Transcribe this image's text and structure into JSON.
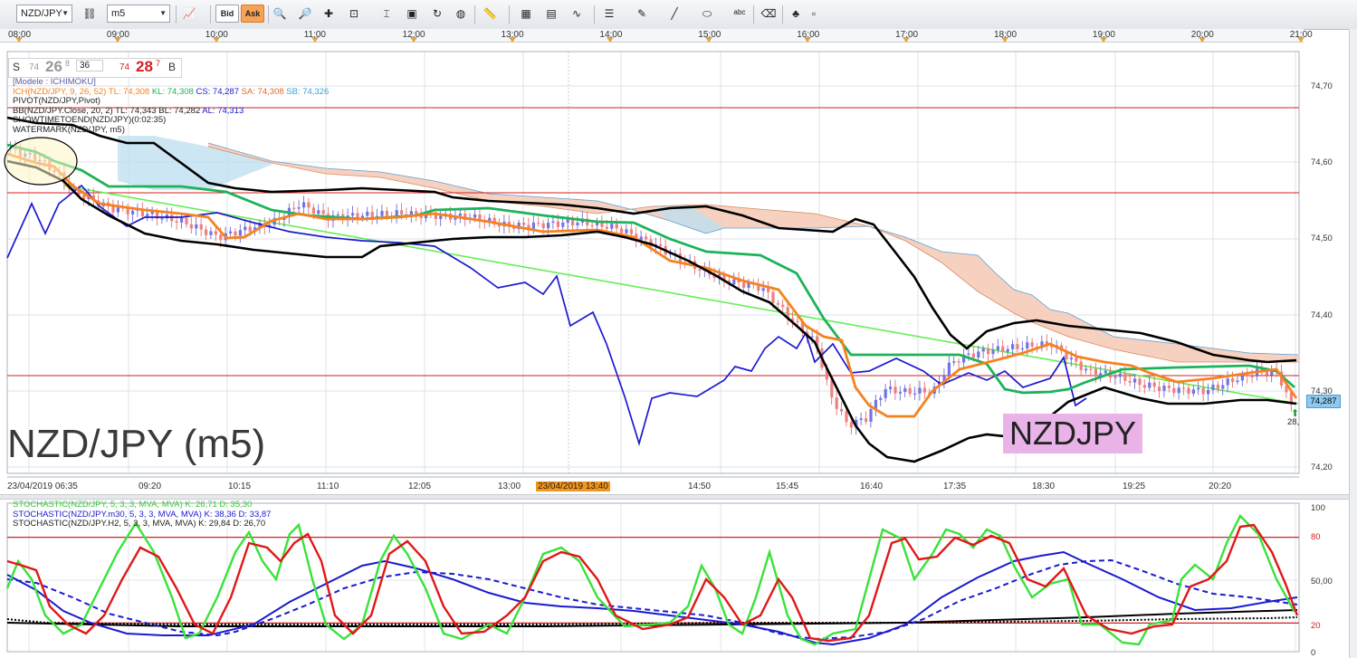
{
  "toolbar": {
    "symbol": "NZD/JPY",
    "timeframe": "m5",
    "bid_label": "Bid",
    "ask_label": "Ask",
    "icons": [
      "link-icon",
      "chart-type-icon",
      "crosshair-icon",
      "zoom-in-icon",
      "zoom-out-icon",
      "zoom-area-icon",
      "cursor-icon",
      "screenshot-icon",
      "refresh-icon",
      "globe-icon",
      "ruler-icon",
      "template-icon",
      "compare-icon",
      "studies-icon",
      "lines-icon",
      "pen-icon",
      "trendline-icon",
      "ellipse-icon",
      "text-icon",
      "eraser-icon",
      "tree-icon",
      "collapse-icon"
    ]
  },
  "time_axis_top": [
    "08:00",
    "09:00",
    "10:00",
    "11:00",
    "12:00",
    "13:00",
    "14:00",
    "15:00",
    "16:00",
    "17:00",
    "18:00",
    "19:00",
    "20:00",
    "21:00"
  ],
  "time_axis_bottom": [
    "23/04/2019 06:35",
    "09:20",
    "10:15",
    "11:10",
    "12:05",
    "13:00",
    "23/04/2019 13:40",
    "14:50",
    "15:45",
    "16:40",
    "17:35",
    "18:30",
    "19:25",
    "20:20"
  ],
  "bidask": {
    "s": "S",
    "bid_small": "74",
    "bid_big": "26",
    "bid_sup": "8",
    "spread": "36",
    "ask_small": "74",
    "ask_big": "28",
    "ask_sup": "7",
    "b": "B"
  },
  "legend": {
    "model": "[Modele : ICHIMOKU]",
    "ichimoku_prefix": "ICH(NZD/JPY, 9, 26, 52)  TL: 74,308  ",
    "ichimoku_kl": "KL: 74,308  ",
    "ichimoku_cs": "CS: 74,287  ",
    "ichimoku_sa": "SA: 74,308  ",
    "ichimoku_sb": "SB: 74,326",
    "pivot": "PIVOT(NZD/JPY,Pivot)",
    "bb_prefix": "BB(NZD/JPY.Close, 20, 2)  TL: 74,343  BL: 74,282  ",
    "bb_al": "AL: 74,313",
    "showtime": "SHOWTIMETOEND(NZD/JPY)(0:02:35)",
    "watermark": "WATERMARK(NZD/JPY, m5)"
  },
  "watermark_text": "NZD/JPY (m5)",
  "pink_label": "NZDJPY",
  "current_price": "74,287",
  "price_axis": [
    "74,70",
    "74,60",
    "74,50",
    "74,40",
    "74,30",
    "74,20"
  ],
  "small_label": "28,",
  "stoch_legend": {
    "m5": "STOCHASTIC(NZD/JPY, 5, 3, 3, MVA, MVA)  K: 26,71  D: 35,30",
    "m30": "STOCHASTIC(NZD/JPY.m30, 5, 3, 3, MVA, MVA)  K: 38,36  D: 33,87",
    "h2": "STOCHASTIC(NZD/JPY.H2, 5, 3, 3, MVA, MVA)  K: 29,84  D: 26,70"
  },
  "stoch_axis": [
    "100",
    "80",
    "50,00",
    "20",
    "0"
  ],
  "colors": {
    "bull": "#7373e6",
    "bear": "#f08080",
    "cloud_bear": "#f5c9b4",
    "cloud_bull": "#bfe0f0",
    "tenkan": "#f58220",
    "kijun": "#1db35a",
    "chikou": "#1a1ad0",
    "bb": "#000000",
    "level": "#d42020",
    "trend": "#66ee55"
  }
}
